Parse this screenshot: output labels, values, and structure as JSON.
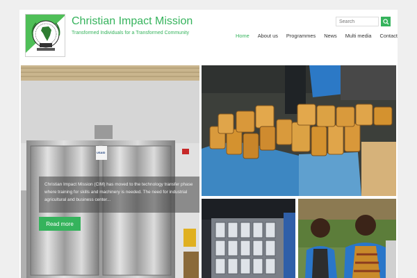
{
  "site": {
    "title": "Christian Impact Mission",
    "tagline": "Transformed Individuals for a Transformed Community"
  },
  "search": {
    "placeholder": "Search"
  },
  "nav": {
    "items": [
      {
        "label": "Home"
      },
      {
        "label": "About us"
      },
      {
        "label": "Programmes"
      },
      {
        "label": "News"
      },
      {
        "label": "Multi media"
      },
      {
        "label": "Contact Us"
      }
    ]
  },
  "hero": {
    "caption": "Christian Impact Mission (CIM) has moved to the technology transfer phase where training for skills and machinery is needed. The need for industrial agricultural and business center...",
    "cta_label": "Read more",
    "cabinet_label": "USAID"
  },
  "gallery": {
    "tiles": [
      {
        "icon": "bread-loaves-photo"
      },
      {
        "icon": "baking-tins-photo"
      },
      {
        "icon": "women-bakers-photo"
      }
    ]
  },
  "colors": {
    "brand_green": "#35b35c"
  }
}
